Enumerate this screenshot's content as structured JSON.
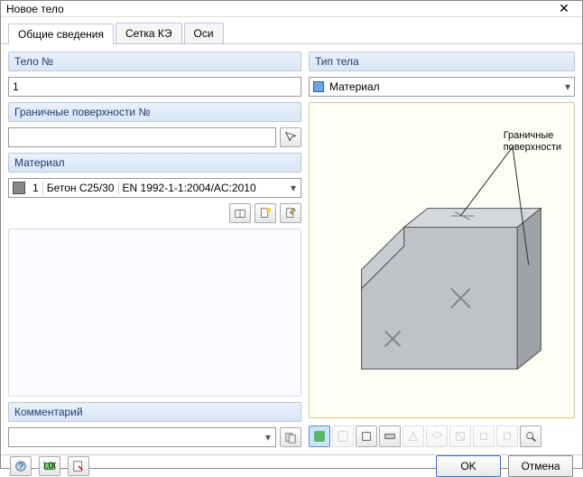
{
  "window": {
    "title": "Новое тело"
  },
  "tabs": [
    {
      "label": "Общие сведения",
      "active": true
    },
    {
      "label": "Сетка КЭ",
      "active": false
    },
    {
      "label": "Оси",
      "active": false
    }
  ],
  "left": {
    "body_no_header": "Тело №",
    "body_no_value": "1",
    "boundary_header": "Граничные поверхности №",
    "boundary_value": "",
    "material_header": "Материал",
    "material": {
      "num": "1",
      "name": "Бетон C25/30",
      "standard": "EN 1992-1-1:2004/AC:2010"
    },
    "comment_header": "Комментарий",
    "comment_value": ""
  },
  "right": {
    "type_header": "Тип тела",
    "type_value": "Материал",
    "preview_label": "Граничные\nповерхности"
  },
  "footer": {
    "ok": "OK",
    "cancel": "Отмена"
  },
  "icons": {
    "pick": "pick-icon",
    "library": "library-icon",
    "new": "new-icon",
    "edit": "edit-icon",
    "comment_import": "comment-import-icon",
    "help": "help-icon",
    "units": "units-icon",
    "pick_footer": "pick-footer-icon"
  }
}
